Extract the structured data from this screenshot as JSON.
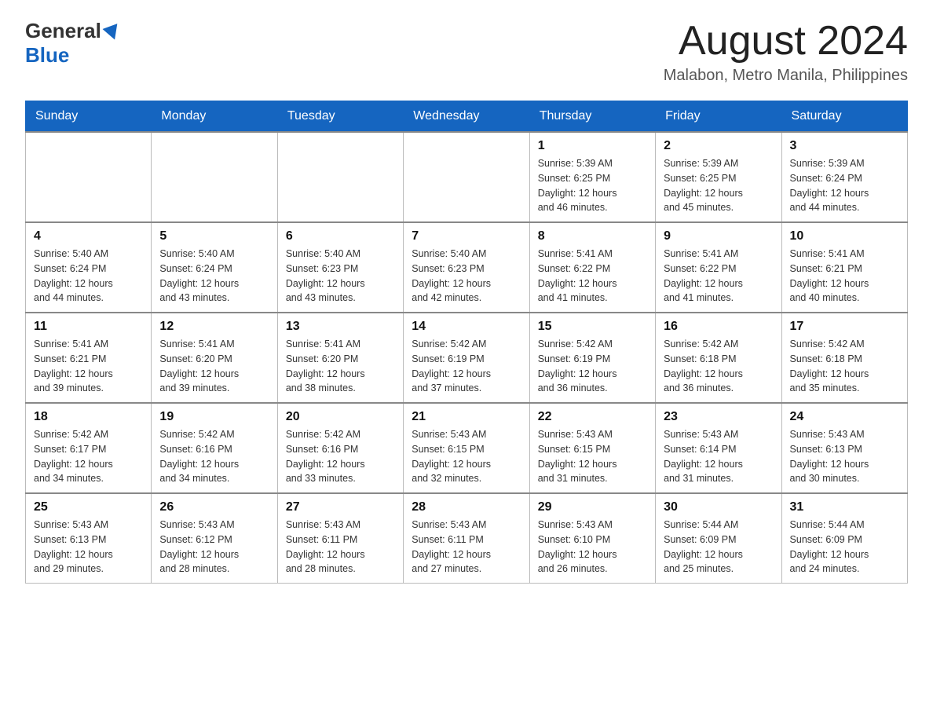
{
  "header": {
    "logo_general": "General",
    "logo_blue": "Blue",
    "month_year": "August 2024",
    "location": "Malabon, Metro Manila, Philippines"
  },
  "weekdays": [
    "Sunday",
    "Monday",
    "Tuesday",
    "Wednesday",
    "Thursday",
    "Friday",
    "Saturday"
  ],
  "weeks": [
    [
      {
        "day": "",
        "info": ""
      },
      {
        "day": "",
        "info": ""
      },
      {
        "day": "",
        "info": ""
      },
      {
        "day": "",
        "info": ""
      },
      {
        "day": "1",
        "info": "Sunrise: 5:39 AM\nSunset: 6:25 PM\nDaylight: 12 hours\nand 46 minutes."
      },
      {
        "day": "2",
        "info": "Sunrise: 5:39 AM\nSunset: 6:25 PM\nDaylight: 12 hours\nand 45 minutes."
      },
      {
        "day": "3",
        "info": "Sunrise: 5:39 AM\nSunset: 6:24 PM\nDaylight: 12 hours\nand 44 minutes."
      }
    ],
    [
      {
        "day": "4",
        "info": "Sunrise: 5:40 AM\nSunset: 6:24 PM\nDaylight: 12 hours\nand 44 minutes."
      },
      {
        "day": "5",
        "info": "Sunrise: 5:40 AM\nSunset: 6:24 PM\nDaylight: 12 hours\nand 43 minutes."
      },
      {
        "day": "6",
        "info": "Sunrise: 5:40 AM\nSunset: 6:23 PM\nDaylight: 12 hours\nand 43 minutes."
      },
      {
        "day": "7",
        "info": "Sunrise: 5:40 AM\nSunset: 6:23 PM\nDaylight: 12 hours\nand 42 minutes."
      },
      {
        "day": "8",
        "info": "Sunrise: 5:41 AM\nSunset: 6:22 PM\nDaylight: 12 hours\nand 41 minutes."
      },
      {
        "day": "9",
        "info": "Sunrise: 5:41 AM\nSunset: 6:22 PM\nDaylight: 12 hours\nand 41 minutes."
      },
      {
        "day": "10",
        "info": "Sunrise: 5:41 AM\nSunset: 6:21 PM\nDaylight: 12 hours\nand 40 minutes."
      }
    ],
    [
      {
        "day": "11",
        "info": "Sunrise: 5:41 AM\nSunset: 6:21 PM\nDaylight: 12 hours\nand 39 minutes."
      },
      {
        "day": "12",
        "info": "Sunrise: 5:41 AM\nSunset: 6:20 PM\nDaylight: 12 hours\nand 39 minutes."
      },
      {
        "day": "13",
        "info": "Sunrise: 5:41 AM\nSunset: 6:20 PM\nDaylight: 12 hours\nand 38 minutes."
      },
      {
        "day": "14",
        "info": "Sunrise: 5:42 AM\nSunset: 6:19 PM\nDaylight: 12 hours\nand 37 minutes."
      },
      {
        "day": "15",
        "info": "Sunrise: 5:42 AM\nSunset: 6:19 PM\nDaylight: 12 hours\nand 36 minutes."
      },
      {
        "day": "16",
        "info": "Sunrise: 5:42 AM\nSunset: 6:18 PM\nDaylight: 12 hours\nand 36 minutes."
      },
      {
        "day": "17",
        "info": "Sunrise: 5:42 AM\nSunset: 6:18 PM\nDaylight: 12 hours\nand 35 minutes."
      }
    ],
    [
      {
        "day": "18",
        "info": "Sunrise: 5:42 AM\nSunset: 6:17 PM\nDaylight: 12 hours\nand 34 minutes."
      },
      {
        "day": "19",
        "info": "Sunrise: 5:42 AM\nSunset: 6:16 PM\nDaylight: 12 hours\nand 34 minutes."
      },
      {
        "day": "20",
        "info": "Sunrise: 5:42 AM\nSunset: 6:16 PM\nDaylight: 12 hours\nand 33 minutes."
      },
      {
        "day": "21",
        "info": "Sunrise: 5:43 AM\nSunset: 6:15 PM\nDaylight: 12 hours\nand 32 minutes."
      },
      {
        "day": "22",
        "info": "Sunrise: 5:43 AM\nSunset: 6:15 PM\nDaylight: 12 hours\nand 31 minutes."
      },
      {
        "day": "23",
        "info": "Sunrise: 5:43 AM\nSunset: 6:14 PM\nDaylight: 12 hours\nand 31 minutes."
      },
      {
        "day": "24",
        "info": "Sunrise: 5:43 AM\nSunset: 6:13 PM\nDaylight: 12 hours\nand 30 minutes."
      }
    ],
    [
      {
        "day": "25",
        "info": "Sunrise: 5:43 AM\nSunset: 6:13 PM\nDaylight: 12 hours\nand 29 minutes."
      },
      {
        "day": "26",
        "info": "Sunrise: 5:43 AM\nSunset: 6:12 PM\nDaylight: 12 hours\nand 28 minutes."
      },
      {
        "day": "27",
        "info": "Sunrise: 5:43 AM\nSunset: 6:11 PM\nDaylight: 12 hours\nand 28 minutes."
      },
      {
        "day": "28",
        "info": "Sunrise: 5:43 AM\nSunset: 6:11 PM\nDaylight: 12 hours\nand 27 minutes."
      },
      {
        "day": "29",
        "info": "Sunrise: 5:43 AM\nSunset: 6:10 PM\nDaylight: 12 hours\nand 26 minutes."
      },
      {
        "day": "30",
        "info": "Sunrise: 5:44 AM\nSunset: 6:09 PM\nDaylight: 12 hours\nand 25 minutes."
      },
      {
        "day": "31",
        "info": "Sunrise: 5:44 AM\nSunset: 6:09 PM\nDaylight: 12 hours\nand 24 minutes."
      }
    ]
  ]
}
